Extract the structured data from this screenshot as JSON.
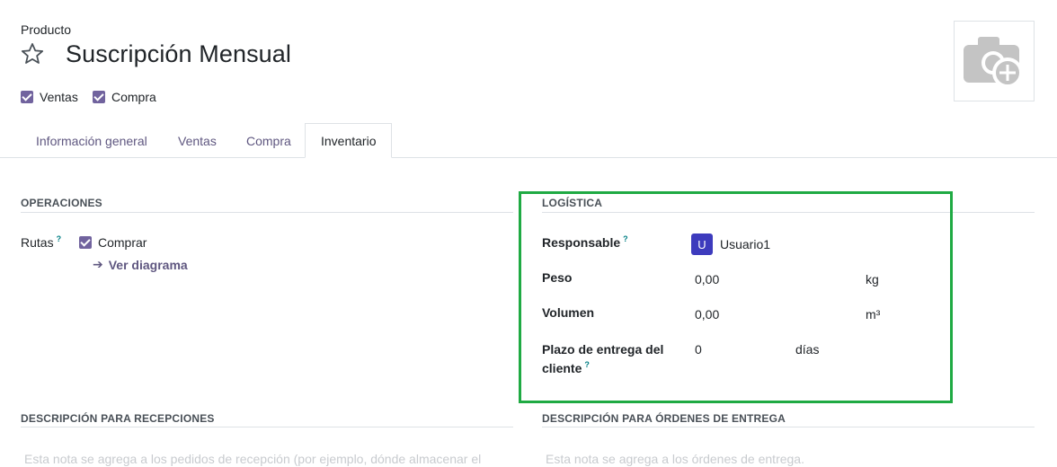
{
  "header": {
    "product_label": "Producto",
    "title": "Suscripción Mensual"
  },
  "options": [
    {
      "label": "Ventas",
      "checked": true
    },
    {
      "label": "Compra",
      "checked": true
    }
  ],
  "tabs": [
    {
      "label": "Información general",
      "active": false
    },
    {
      "label": "Ventas",
      "active": false
    },
    {
      "label": "Compra",
      "active": false
    },
    {
      "label": "Inventario",
      "active": true
    }
  ],
  "operaciones": {
    "title": "OPERACIONES",
    "rutas_label": "Rutas",
    "help": "?",
    "route_option": "Comprar",
    "diagram_link": "Ver diagrama"
  },
  "logistica": {
    "title": "LOGÍSTICA",
    "responsable": {
      "label": "Responsable",
      "help": "?",
      "avatar_letter": "U",
      "value": "Usuario1"
    },
    "peso": {
      "label": "Peso",
      "value": "0,00",
      "unit": "kg"
    },
    "volumen": {
      "label": "Volumen",
      "value": "0,00",
      "unit": "m³"
    },
    "plazo": {
      "label_line1": "Plazo de entrega del",
      "label_line2": "cliente",
      "help": "?",
      "value": "0",
      "unit": "días"
    }
  },
  "descripcion_recepciones": {
    "title": "DESCRIPCIÓN PARA RECEPCIONES",
    "placeholder": "Esta nota se agrega a los pedidos de recepción (por ejemplo, dónde almacenar el"
  },
  "descripcion_entrega": {
    "title": "DESCRIPCIÓN PARA ÓRDENES DE ENTREGA",
    "placeholder": "Esta nota se agrega a los órdenes de entrega."
  },
  "colors": {
    "accent": "#71639e",
    "avatar": "#3d3bbd",
    "highlight": "#1faa43",
    "help": "#017e84"
  }
}
